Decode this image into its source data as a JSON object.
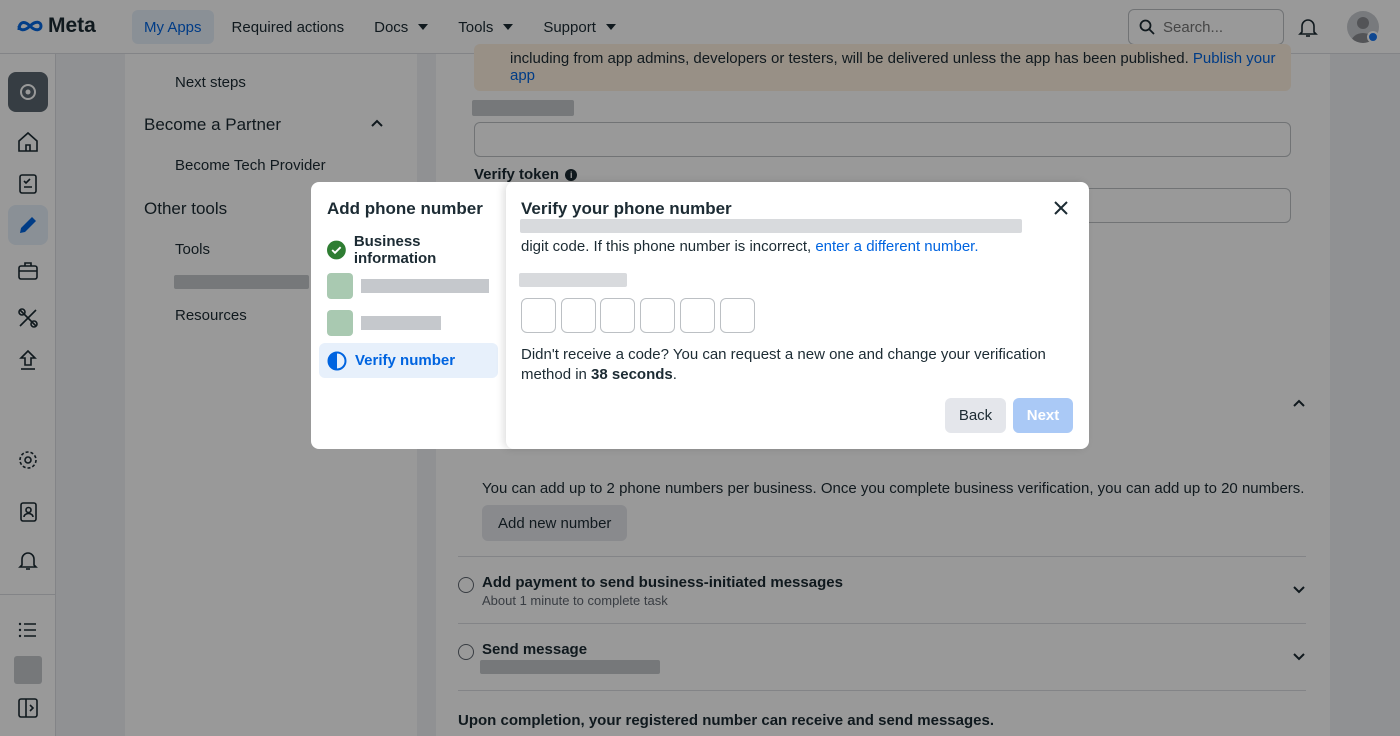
{
  "topbar": {
    "logo_text": "Meta",
    "nav": [
      "My Apps",
      "Required actions",
      "Docs",
      "Tools",
      "Support"
    ],
    "search_placeholder": "Search..."
  },
  "subnav": {
    "next_steps": "Next steps",
    "become_partner": "Become a Partner",
    "become_tech_provider": "Become Tech Provider",
    "other_tools": "Other tools",
    "tools": "Tools",
    "resources": "Resources"
  },
  "main": {
    "banner_line2": "including from app admins, developers or testers, will be delivered unless the app has been published.",
    "banner_link": "Publish your app",
    "verify_token_label": "Verify token",
    "add_note": "You can add up to 2 phone numbers per business. Once you complete business verification, you can add up to 20 numbers.",
    "add_new_number": "Add new number",
    "task_payment_title": "Add payment to send business-initiated messages",
    "task_payment_sub": "About 1 minute to complete task",
    "task_send_title": "Send message",
    "completion_note": "Upon completion, your registered number can receive and send messages."
  },
  "dialog": {
    "left_title": "Add phone number",
    "steps": [
      {
        "label": "Business information",
        "state": "done"
      },
      {
        "label": "",
        "state": "pending"
      },
      {
        "label": "",
        "state": "pending"
      },
      {
        "label": "Verify number",
        "state": "current"
      }
    ],
    "title": "Verify your phone number",
    "desc_tail": "digit code. If this phone number is incorrect,",
    "desc_link": "enter a different number.",
    "resend_text": "Didn't receive a code? You can request a new one and change your verification method in",
    "countdown": "38 seconds",
    "back_label": "Back",
    "next_label": "Next"
  },
  "colors": {
    "accent": "#0064e0",
    "success": "#2e7d32",
    "next_disabled": "#aac9f6"
  }
}
